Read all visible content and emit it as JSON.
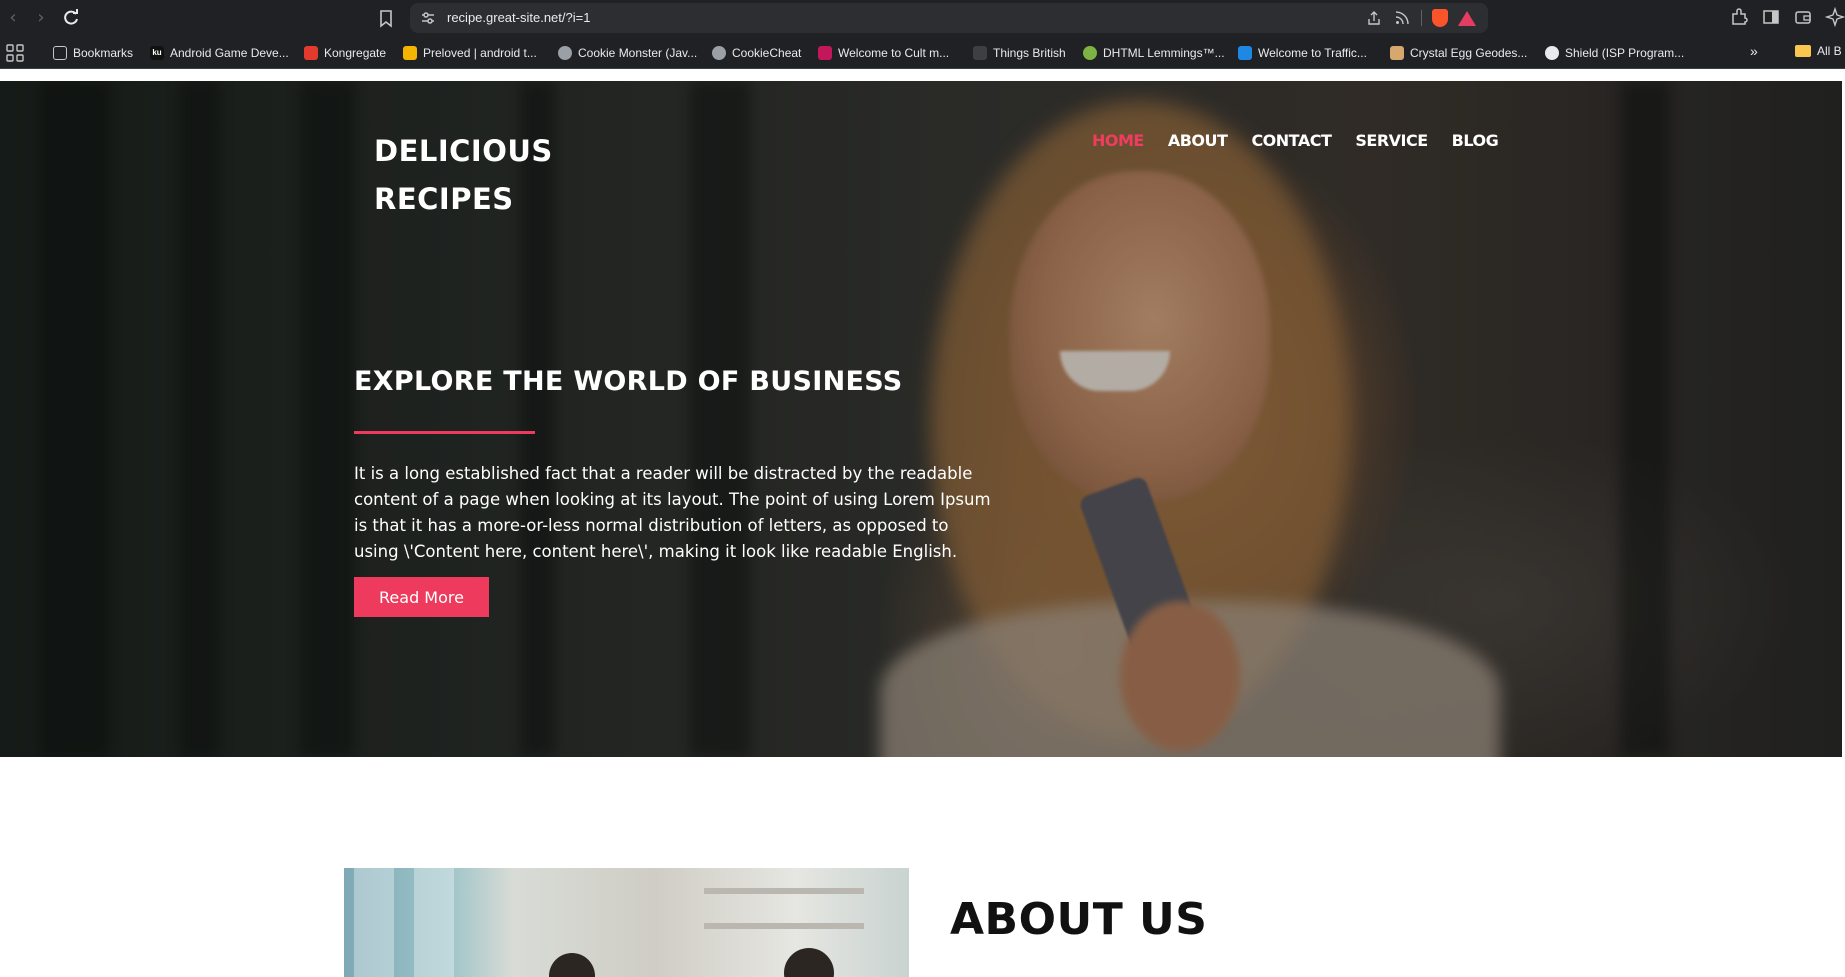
{
  "browser": {
    "url": "recipe.great-site.net/?i=1",
    "bookmarks": [
      {
        "label": "Bookmarks",
        "color": "#e8eaed"
      },
      {
        "label": "Android Game Deve...",
        "color": "#ffffff"
      },
      {
        "label": "Kongregate",
        "color": "#e23b2e"
      },
      {
        "label": "Preloved | android t...",
        "color": "#f4b400"
      },
      {
        "label": "Cookie Monster (Jav...",
        "color": "#9aa0a6"
      },
      {
        "label": "CookieCheat",
        "color": "#9aa0a6"
      },
      {
        "label": "Welcome to Cult m...",
        "color": "#c2185b"
      },
      {
        "label": "Things British",
        "color": "#3c4043"
      },
      {
        "label": "DHTML Lemmings™...",
        "color": "#7cb342"
      },
      {
        "label": "Welcome to Traffic...",
        "color": "#1e88e5"
      },
      {
        "label": "Crystal Egg Geodes...",
        "color": "#d7a86e"
      },
      {
        "label": "Shield (ISP Program...",
        "color": "#e8eaed"
      }
    ],
    "more_label": "»",
    "all_bookmarks_label": "All B"
  },
  "site": {
    "logo_line1": "DELICIOUS",
    "logo_line2": "RECIPES",
    "menu": [
      "HOME",
      "ABOUT",
      "CONTACT",
      "SERVICE",
      "BLOG"
    ],
    "active_menu": "HOME",
    "accent_color": "#ee3a5c"
  },
  "hero": {
    "title": "EXPLORE THE WORLD OF BUSINESS",
    "text": "It is a long established fact that a reader will be distracted by the readable content of a page when looking at its layout. The point of using Lorem Ipsum is that it has a more-or-less normal distribution of letters, as opposed to using \\'Content here, content here\\', making it look like readable English.",
    "button": "Read More"
  },
  "about": {
    "title": "ABOUT US"
  }
}
